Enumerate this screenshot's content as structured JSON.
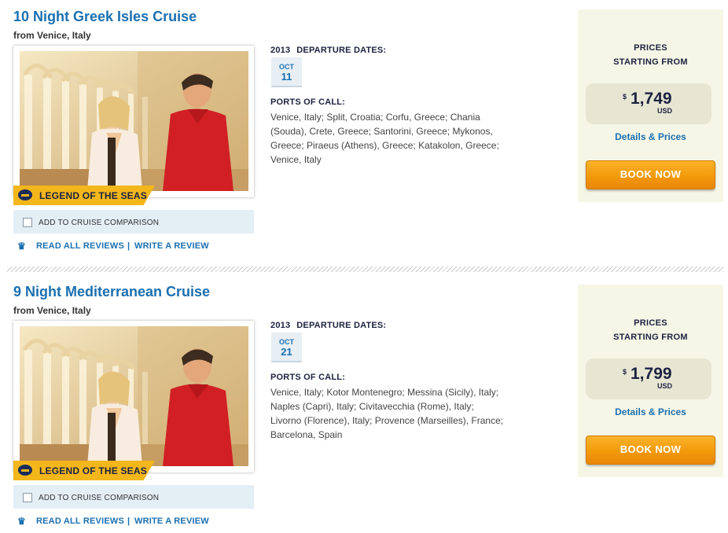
{
  "cruises": [
    {
      "title": "10 Night Greek Isles Cruise",
      "from": "from Venice, Italy",
      "ship": "LEGEND OF THE SEAS",
      "compare_label": "ADD TO CRUISE COMPARISON",
      "read_reviews": "READ ALL REVIEWS",
      "separator": "|",
      "write_review": "WRITE A REVIEW",
      "year": "2013",
      "departure_label": "DEPARTURE DATES:",
      "date_month": "OCT",
      "date_day": "11",
      "ports_label": "PORTS OF CALL:",
      "ports": "Venice, Italy; Split, Croatia; Corfu, Greece; Chania (Souda), Crete, Greece; Santorini, Greece; Mykonos, Greece; Piraeus (Athens), Greece; Katakolon, Greece; Venice, Italy",
      "prices_line1": "PRICES",
      "prices_line2": "STARTING FROM",
      "currency_symbol": "$",
      "price": "1,749",
      "currency_code": "USD",
      "details_link": "Details & Prices",
      "book_button": "BOOK NOW"
    },
    {
      "title": "9 Night Mediterranean Cruise",
      "from": "from Venice, Italy",
      "ship": "LEGEND OF THE SEAS",
      "compare_label": "ADD TO CRUISE COMPARISON",
      "read_reviews": "READ ALL REVIEWS",
      "separator": "|",
      "write_review": "WRITE A REVIEW",
      "year": "2013",
      "departure_label": "DEPARTURE DATES:",
      "date_month": "OCT",
      "date_day": "21",
      "ports_label": "PORTS OF CALL:",
      "ports": "Venice, Italy; Kotor Montenegro; Messina (Sicily), Italy; Naples (Capri), Italy; Civitavecchia (Rome), Italy; Livorno (Florence), Italy; Provence (Marseilles), France; Barcelona, Spain",
      "prices_line1": "PRICES",
      "prices_line2": "STARTING FROM",
      "currency_symbol": "$",
      "price": "1,799",
      "currency_code": "USD",
      "details_link": "Details & Prices",
      "book_button": "BOOK NOW"
    }
  ],
  "colors": {
    "link_blue": "#1a6fb0",
    "navy": "#1c2240",
    "ship_tag_gold": "#f3b61b",
    "book_orange": "#f39a0b",
    "price_panel": "#f6f6e6"
  },
  "icons": {
    "ship_logo": "royal-caribbean-crown-anchor-icon",
    "reviews": "crown-anchor-icon",
    "checkbox": "checkbox-icon"
  }
}
